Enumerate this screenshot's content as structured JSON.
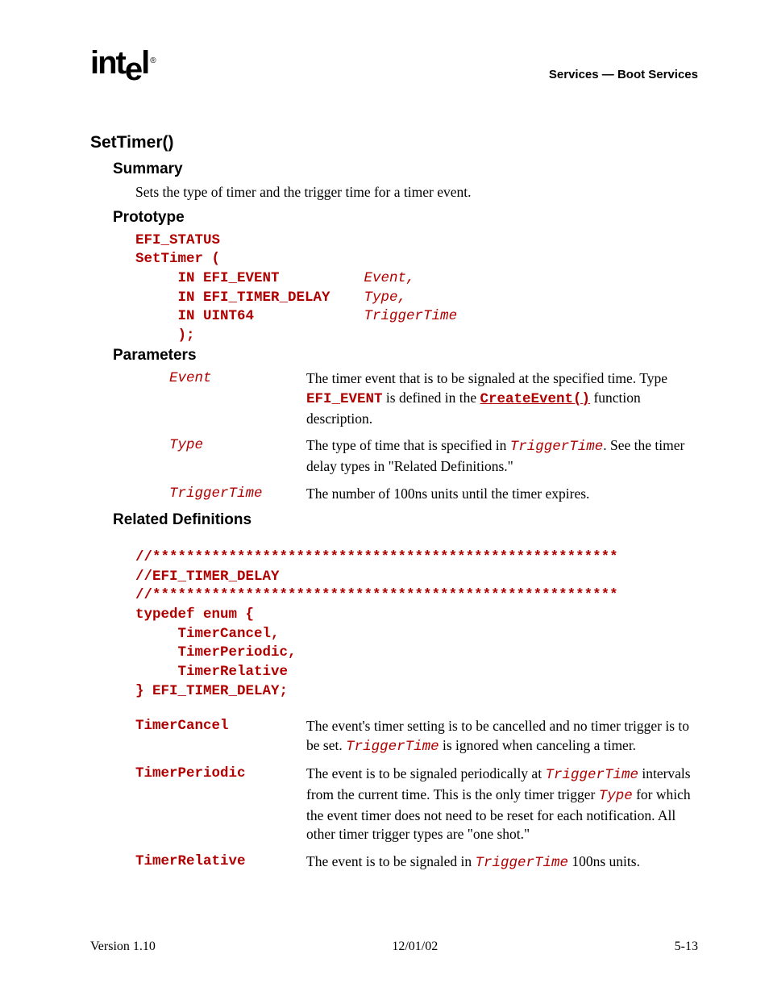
{
  "header": {
    "logo": "intel",
    "right": "Services — Boot Services"
  },
  "h1": "SetTimer()",
  "summary": {
    "heading": "Summary",
    "text": "Sets the type of timer and the trigger time for a timer event."
  },
  "prototype": {
    "heading": "Prototype",
    "l1": "EFI_STATUS",
    "l2": "SetTimer (",
    "l3a": "     IN EFI_EVENT          ",
    "l3b": "Event,",
    "l4a": "     IN EFI_TIMER_DELAY    ",
    "l4b": "Type,",
    "l5a": "     IN UINT64             ",
    "l5b": "TriggerTime",
    "l6": "     );"
  },
  "parameters": {
    "heading": "Parameters",
    "rows": [
      {
        "name": "Event",
        "d1": "The timer event that is to be signaled at the specified time.  Type ",
        "mono1": "EFI_EVENT",
        "d2": " is defined in the ",
        "link": "CreateEvent()",
        "d3": " function description."
      },
      {
        "name": "Type",
        "d1": "The type of time that is specified in ",
        "mono1": "TriggerTime",
        "d2": ".  See the timer delay types in \"Related Definitions.\""
      },
      {
        "name": "TriggerTime",
        "d1": "The number of 100ns units until the timer expires."
      }
    ]
  },
  "related": {
    "heading": "Related Definitions",
    "stars": "//*******************************************************",
    "comment": "//EFI_TIMER_DELAY",
    "typedef": "typedef enum {",
    "m1": "     TimerCancel,",
    "m2": "     TimerPeriodic,",
    "m3": "     TimerRelative",
    "close": "} EFI_TIMER_DELAY;",
    "defs": [
      {
        "name": "TimerCancel",
        "d1": "The event's timer setting is to be cancelled and no timer trigger is to be set.  ",
        "mono1": "TriggerTime",
        "d2": " is ignored when canceling a timer."
      },
      {
        "name": "TimerPeriodic",
        "d1": "The event is to be signaled periodically at ",
        "mono1": "TriggerTime",
        "d2": " intervals from the current time.  This is the only timer trigger ",
        "mono2": "Type",
        "d3": " for which the event timer does not need to be reset for each notification.  All other timer trigger types are \"one shot.\""
      },
      {
        "name": "TimerRelative",
        "d1": "The event is to be signaled in ",
        "mono1": "TriggerTime",
        "d2": " 100ns units."
      }
    ]
  },
  "footer": {
    "left": "Version 1.10",
    "center": "12/01/02",
    "right": "5-13"
  }
}
